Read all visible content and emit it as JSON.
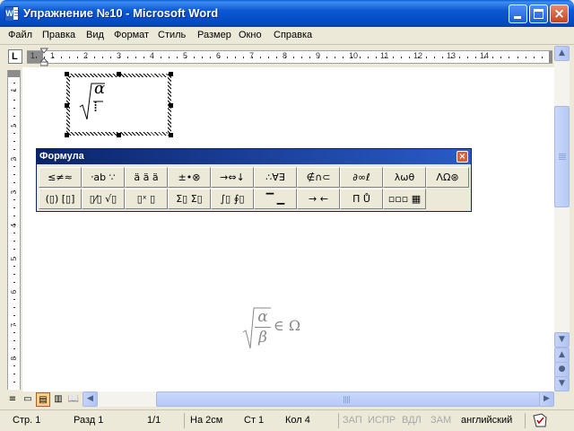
{
  "window": {
    "title": "Упражнение №10 - Microsoft Word",
    "app_icon": "word-icon",
    "app_icon_letter": "W",
    "minimize_icon": "minimize-icon",
    "maximize_icon": "maximize-icon",
    "close_icon": "close-icon",
    "close_glyph": "×"
  },
  "menu": [
    "Файл",
    "Правка",
    "Вид",
    "Формат",
    "Стиль",
    "Размер",
    "Окно",
    "Справка"
  ],
  "ruler": {
    "tab_selector": "L",
    "numbers": [
      "1",
      "2",
      "1",
      "2",
      "3",
      "4",
      "5",
      "6",
      "7",
      "8",
      "9",
      "10",
      "11",
      "12",
      "13",
      "14"
    ],
    "vertical_numbers": [
      "1",
      "2",
      "1",
      "2",
      "3",
      "4",
      "5",
      "6",
      "7",
      "8",
      "9",
      "10"
    ]
  },
  "equation_object": {
    "numerator": "α",
    "cursor_glyph": "⁞"
  },
  "formula_toolbar": {
    "title": "Формула",
    "close_glyph": "×",
    "row1": [
      {
        "name": "relations-palette",
        "label": "≤≠≈"
      },
      {
        "name": "spaces-palette",
        "label": "⸱ab ∵"
      },
      {
        "name": "embellishments-palette",
        "label": "ä ä ä"
      },
      {
        "name": "operators-palette",
        "label": "±•⊗"
      },
      {
        "name": "arrows-palette",
        "label": "→⇔↓"
      },
      {
        "name": "logic-palette",
        "label": "∴∀∃"
      },
      {
        "name": "set-theory-palette",
        "label": "∉∩⊂"
      },
      {
        "name": "misc-symbols-palette",
        "label": "∂∞ℓ"
      },
      {
        "name": "greek-lowercase-palette",
        "label": "λωθ"
      },
      {
        "name": "greek-uppercase-palette",
        "label": "ΛΩ⊛"
      }
    ],
    "row2": [
      {
        "name": "fences-palette",
        "label": "(▯) [▯]"
      },
      {
        "name": "fractions-radicals-palette",
        "label": "▯⁄▯ √▯"
      },
      {
        "name": "subscripts-palette",
        "label": "▯ˣ ▯"
      },
      {
        "name": "summations-palette",
        "label": "Σ▯ Σ▯"
      },
      {
        "name": "integrals-palette",
        "label": "∫▯ ∮▯"
      },
      {
        "name": "bars-palette",
        "label": "▔ ▁"
      },
      {
        "name": "labeled-arrows-palette",
        "label": "→ ←"
      },
      {
        "name": "products-palette",
        "label": "Π̄ Ů"
      },
      {
        "name": "matrices-palette",
        "label": "▫▫▫ ▦"
      }
    ]
  },
  "display_equation": {
    "numerator": "α",
    "denominator": "β",
    "relation": "∈ Ω"
  },
  "scroll": {
    "up": "▲",
    "down": "▼",
    "left": "◀",
    "right": "▶",
    "prev_page": "▲",
    "select_browse": "●",
    "next_page": "▼"
  },
  "view_buttons": [
    "≡",
    "▭",
    "▤",
    "▥",
    "📖"
  ],
  "status": {
    "page": "Стр. 1",
    "section": "Разд 1",
    "pages": "1/1",
    "at": "На 2см",
    "line": "Ст 1",
    "column": "Кол 4",
    "rec": "ЗАП",
    "trk": "ИСПР",
    "ext": "ВДЛ",
    "ovr": "ЗАМ",
    "language": "английский",
    "spell_icon": "spelling-check-icon"
  }
}
